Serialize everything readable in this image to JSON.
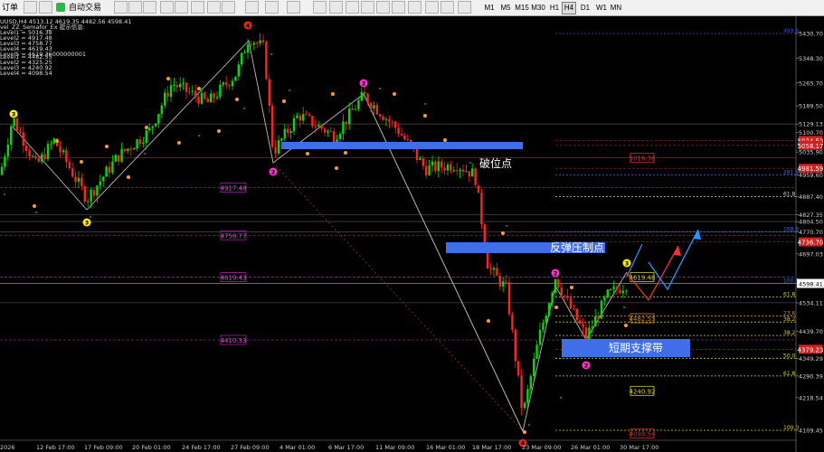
{
  "toolbar": {
    "order_label": "订单",
    "autotrade_label": "自动交易",
    "timeframes": [
      "M1",
      "M5",
      "M15",
      "M30",
      "H1",
      "H4",
      "D1",
      "W1",
      "MN"
    ],
    "active_timeframe": "H4"
  },
  "info": {
    "symbol_line": "UUSD,H4  4513.12 4619.35 4482.56 4598.41",
    "indicator_line": "vel_ZZ_Semafor_Ex 提示信息:",
    "levels": [
      "Level1 = 5016.38",
      "Level2 = 4917.48",
      "Level3 = 4758.77",
      "Level4 = 4619.43",
      "Level5 = 4619.36000000001"
    ],
    "levels2": [
      "Level1 = 4482.55",
      "Level2 = 4325.25",
      "Level3 = 4240.92",
      "Level4 = 4098.54"
    ]
  },
  "price_axis": {
    "ticks": [
      "5430.70",
      "5348.30",
      "5265.70",
      "5189.50",
      "5129.13",
      "5100.70",
      "5035.90",
      "4959.60",
      "4887.40",
      "4827.35",
      "4804.50",
      "4770.70",
      "4697.03",
      "4598.41",
      "4534.11",
      "4439.70",
      "4349.29",
      "4290.39",
      "4218.54",
      "4109.45"
    ],
    "current_price": "4598.41",
    "levels": [
      {
        "price": 5129.13,
        "label": "5129.13",
        "color": "#ffffff"
      },
      {
        "price": 5016.38,
        "label": "5016.38",
        "color": "#cc2222"
      },
      {
        "price": 4827.35,
        "label": "4827.35",
        "color": "#ffffff"
      },
      {
        "price": 4804.5,
        "label": "4804.50",
        "color": "#ffffff"
      },
      {
        "price": 4770.7,
        "label": "4770.70",
        "color": "#ffffff"
      },
      {
        "price": 4534.11,
        "label": "4534.11",
        "color": "#ffffff"
      }
    ]
  },
  "fib": {
    "upper": [
      {
        "price": 5430.7,
        "label": "499.8",
        "color": "#4444cc"
      },
      {
        "price": 4959.6,
        "label": "261.8",
        "color": "#4466cc"
      },
      {
        "price": 4887.4,
        "label": "61.8",
        "color": "#cccccc"
      },
      {
        "price": 4770.7,
        "label": "168.8",
        "color": "#4466cc"
      },
      {
        "price": 4598.41,
        "label": "100.0",
        "color": "#4466cc"
      }
    ],
    "lower": [
      {
        "price": 4553.0,
        "label": "61.8",
        "color": "#cccc33"
      },
      {
        "price": 4490.0,
        "label": "23.6",
        "color": "#cc8833"
      },
      {
        "price": 4470.0,
        "label": "38.2",
        "color": "#cccc33"
      },
      {
        "price": 4425.0,
        "label": "38.2",
        "color": "#cccc33"
      },
      {
        "price": 4349.29,
        "label": "50.0",
        "color": "#cccc33"
      },
      {
        "price": 4290.39,
        "label": "61.8",
        "color": "#cccc33"
      },
      {
        "price": 4109.45,
        "label": "100.0",
        "color": "#cccc33"
      }
    ]
  },
  "level_boxes": [
    {
      "label": "4917.48",
      "price": 4917.48,
      "color": "#a020a0"
    },
    {
      "label": "4758.77",
      "price": 4758.77,
      "color": "#a020a0"
    },
    {
      "label": "4619.43",
      "price": 4619.43,
      "color": "#a020a0"
    },
    {
      "label": "4410.33",
      "price": 4410.33,
      "color": "#a020a0"
    }
  ],
  "zz_labels": [
    {
      "label": "5016.38",
      "price": 5016.38,
      "color": "#cc3333"
    },
    {
      "label": "4619.48",
      "price": 4619.48,
      "color": "#cccc33"
    },
    {
      "label": "4482.55",
      "price": 4482.55,
      "color": "#cc8833"
    },
    {
      "label": "4240.92",
      "price": 4240.92,
      "color": "#cccc33"
    },
    {
      "label": "4098.54",
      "price": 4098.54,
      "color": "#cc3333"
    }
  ],
  "right_badges": [
    {
      "label": "5074.53",
      "price": 5074.53
    },
    {
      "label": "5058.17",
      "price": 5058.17
    },
    {
      "label": "4981.59",
      "price": 4981.59
    },
    {
      "label": "4736.70",
      "price": 4736.7
    },
    {
      "label": "4379.23",
      "price": 4379.23
    }
  ],
  "annotations": {
    "break_point": "破位点",
    "rebound_pressure": "反弹压制点",
    "support_zone": "短期支撑带"
  },
  "time_axis": [
    "2026",
    "12 Feb 17:00",
    "17 Feb 09:00",
    "20 Feb 01:00",
    "24 Feb 17:00",
    "27 Feb 09:00",
    "4 Mar 01:00",
    "6 Mar 17:00",
    "11 Mar 09:00",
    "16 Mar 01:00",
    "18 Mar 17:00",
    "23 Mar 09:00",
    "26 Mar 01:00",
    "30 Mar 17:00"
  ],
  "semafor_markers": [
    {
      "label": "3",
      "color": "#ffee00"
    },
    {
      "label": "3",
      "color": "#ffee00"
    },
    {
      "label": "4",
      "color": "#ee2222"
    },
    {
      "label": "2",
      "color": "#ff33cc"
    },
    {
      "label": "2",
      "color": "#ff33cc"
    },
    {
      "label": "2",
      "color": "#ff33cc"
    },
    {
      "label": "2",
      "color": "#ff33cc"
    },
    {
      "label": "3",
      "color": "#ffee00"
    },
    {
      "label": "4",
      "color": "#ee2222"
    }
  ],
  "colors": {
    "bull": "#00dd00",
    "bear": "#ff2222",
    "zone_blue": "#3f6ee8",
    "axis_text": "#cfcfcf",
    "grid_dash": "#6a2a6a"
  }
}
